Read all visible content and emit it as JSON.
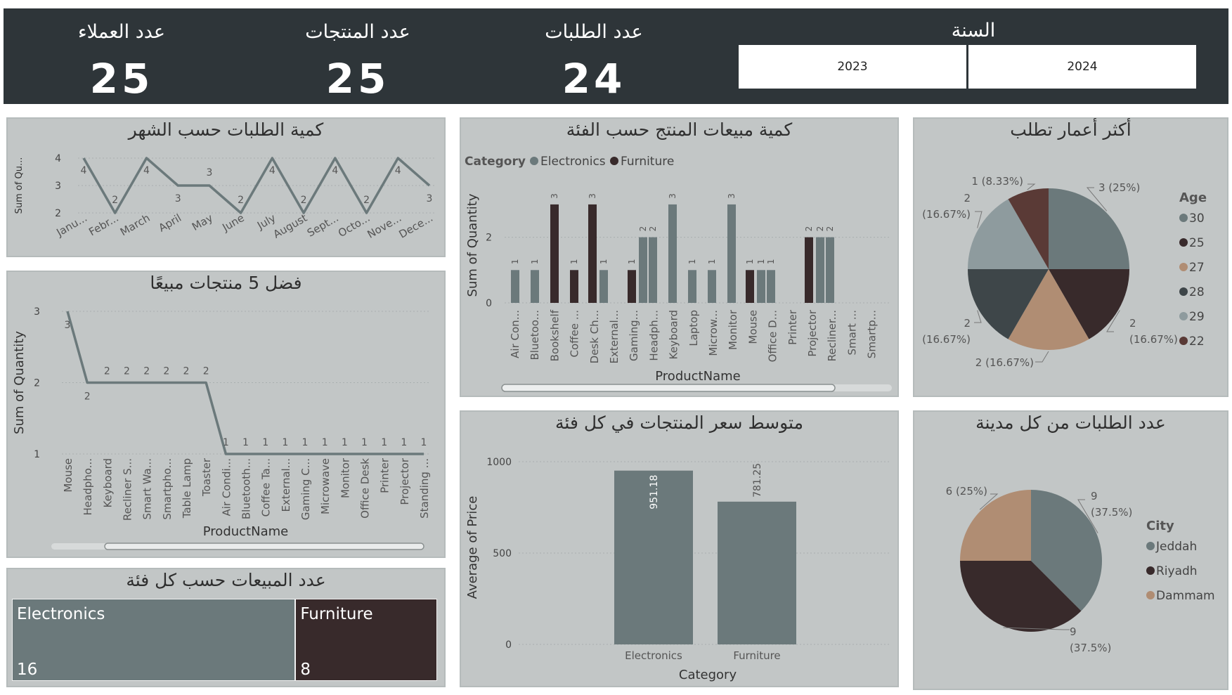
{
  "header": {
    "kpis": [
      {
        "label": "عدد العملاء",
        "value": "25"
      },
      {
        "label": "عدد المنتجات",
        "value": "25"
      },
      {
        "label": "عدد الطلبات",
        "value": "24"
      }
    ],
    "year_slicer": {
      "title": "السنة",
      "options": [
        "2023",
        "2024"
      ]
    }
  },
  "titles": {
    "orders_by_month": "كمية الطلبات حسب الشهر",
    "top5": "فضل 5 منتجات مبيعًا",
    "sales_by_category": "عدد المبيعات حسب كل فئة",
    "qty_by_product": "كمية مبيعات المنتج حسب الفئة",
    "avg_price": "متوسط سعر المنتجات في كل فئة",
    "ages": "أكثر أعمار تطلب",
    "cities": "عدد الطلبات من كل مدينة"
  },
  "colors": {
    "electronics": "#6b797b",
    "furniture": "#382a2b",
    "line": "#6b797b",
    "dark": "#2e3539"
  },
  "chart_data": [
    {
      "id": "orders_by_month",
      "type": "line",
      "ylabel": "Sum of Qu...",
      "categories": [
        "Janu...",
        "Febr...",
        "March",
        "April",
        "May",
        "June",
        "July",
        "August",
        "Sept...",
        "Octo...",
        "Nove...",
        "Dece..."
      ],
      "values": [
        4,
        2,
        4,
        3,
        3,
        2,
        4,
        2,
        4,
        2,
        4,
        3
      ],
      "yticks": [
        2,
        3,
        4
      ],
      "ylim": [
        2,
        4
      ]
    },
    {
      "id": "top5",
      "type": "line",
      "xlabel": "ProductName",
      "ylabel": "Sum of Quantity",
      "categories": [
        "Mouse",
        "Headpho...",
        "Keyboard",
        "Recliner S...",
        "Smart Wa...",
        "Smartpho...",
        "Table Lamp",
        "Toaster",
        "Air Condi...",
        "Bluetooth...",
        "Coffee Ta...",
        "External...",
        "Gaming C...",
        "Microwave",
        "Monitor",
        "Office Desk",
        "Printer",
        "Projector",
        "Standing ..."
      ],
      "values": [
        3,
        2,
        2,
        2,
        2,
        2,
        2,
        2,
        1,
        1,
        1,
        1,
        1,
        1,
        1,
        1,
        1,
        1,
        1
      ],
      "yticks": [
        1,
        2,
        3
      ],
      "ylim": [
        1,
        3
      ]
    },
    {
      "id": "sales_by_category",
      "type": "treemap",
      "categories": [
        "Electronics",
        "Furniture"
      ],
      "values": [
        16,
        8
      ]
    },
    {
      "id": "qty_by_product",
      "type": "bar",
      "xlabel": "ProductName",
      "ylabel": "Sum of Quantity",
      "legend_title": "Category",
      "legend": [
        "Electronics",
        "Furniture"
      ],
      "categories": [
        "Air Con...",
        "Bluetoo...",
        "Bookshelf",
        "Coffee ...",
        "Desk Ch...",
        "External...",
        "Gaming...",
        "Headph...",
        "Keyboard",
        "Laptop",
        "Microw...",
        "Monitor",
        "Mouse",
        "Office D...",
        "Printer",
        "Projector",
        "Recliner...",
        "Smart ...",
        "Smartp..."
      ],
      "bars": [
        [
          {
            "s": "Electronics",
            "v": 1
          }
        ],
        [
          {
            "s": "Electronics",
            "v": 1
          }
        ],
        [
          {
            "s": "Furniture",
            "v": 3
          }
        ],
        [
          {
            "s": "Furniture",
            "v": 1
          }
        ],
        [
          {
            "s": "Furniture",
            "v": 3
          },
          {
            "s": "Electronics",
            "v": 1
          }
        ],
        [],
        [
          {
            "s": "Furniture",
            "v": 1
          },
          {
            "s": "Electronics",
            "v": 2
          }
        ],
        [
          {
            "s": "Electronics",
            "v": 2
          }
        ],
        [
          {
            "s": "Electronics",
            "v": 3
          }
        ],
        [
          {
            "s": "Electronics",
            "v": 1
          }
        ],
        [
          {
            "s": "Electronics",
            "v": 1
          }
        ],
        [
          {
            "s": "Electronics",
            "v": 3
          }
        ],
        [
          {
            "s": "Furniture",
            "v": 1
          },
          {
            "s": "Electronics",
            "v": 1
          }
        ],
        [
          {
            "s": "Electronics",
            "v": 1
          }
        ],
        [],
        [
          {
            "s": "Furniture",
            "v": 2
          },
          {
            "s": "Electronics",
            "v": 2
          }
        ],
        [
          {
            "s": "Electronics",
            "v": 2
          }
        ]
      ],
      "yticks": [
        0,
        2
      ],
      "ylim": [
        0,
        3
      ]
    },
    {
      "id": "avg_price",
      "type": "bar",
      "xlabel": "Category",
      "ylabel": "Average of Price",
      "categories": [
        "Electronics",
        "Furniture"
      ],
      "values": [
        951.18,
        781.25
      ],
      "labels": [
        "951.18",
        "781.25"
      ],
      "yticks": [
        0,
        500,
        1000
      ],
      "ylim": [
        0,
        1000
      ]
    },
    {
      "id": "ages",
      "type": "pie",
      "legend_title": "Age",
      "slices": [
        {
          "label": "30",
          "value": 3,
          "text": "3 (25%)",
          "color": "#6b797b"
        },
        {
          "label": "25",
          "value": 2,
          "text": "2 (16.67%)",
          "color": "#382a2b"
        },
        {
          "label": "27",
          "value": 2,
          "text": "2 (16.67%)",
          "color": "#b08d73"
        },
        {
          "label": "28",
          "value": 2,
          "text": "2 (16.67%)",
          "color": "#3e4649"
        },
        {
          "label": "29",
          "value": 2,
          "text": "2 (16.67%)",
          "color": "#8e9b9e"
        },
        {
          "label": "22",
          "value": 1,
          "text": "1 (8.33%)",
          "color": "#5a3a36"
        }
      ]
    },
    {
      "id": "cities",
      "type": "pie",
      "legend_title": "City",
      "slices": [
        {
          "label": "Jeddah",
          "value": 9,
          "text": "9 (37.5%)",
          "color": "#6b797b"
        },
        {
          "label": "Riyadh",
          "value": 9,
          "text": "9 (37.5%)",
          "color": "#382a2b"
        },
        {
          "label": "Dammam",
          "value": 6,
          "text": "6 (25%)",
          "color": "#b08d73"
        }
      ]
    }
  ]
}
